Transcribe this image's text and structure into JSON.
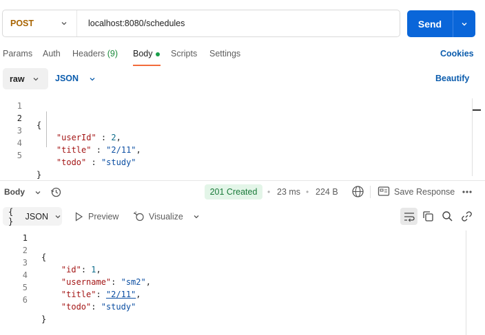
{
  "request": {
    "method": "POST",
    "url": "localhost:8080/schedules",
    "send_label": "Send"
  },
  "req_tabs": {
    "params": "Params",
    "auth": "Auth",
    "headers": "Headers",
    "headers_count": "(9)",
    "body": "Body",
    "scripts": "Scripts",
    "settings": "Settings",
    "cookies": "Cookies"
  },
  "body_mode": {
    "raw": "raw",
    "format": "JSON",
    "beautify": "Beautify"
  },
  "request_body": {
    "line_numbers": [
      "1",
      "2",
      "3",
      "4",
      "5"
    ],
    "lines": [
      {
        "segments": [
          {
            "t": "{",
            "c": "punct"
          }
        ]
      },
      {
        "segments": [
          {
            "t": "    ",
            "c": "punct"
          },
          {
            "t": "\"userId\"",
            "c": "key"
          },
          {
            "t": " : ",
            "c": "punct"
          },
          {
            "t": "2",
            "c": "num"
          },
          {
            "t": ",",
            "c": "punct"
          }
        ]
      },
      {
        "segments": [
          {
            "t": "    ",
            "c": "punct"
          },
          {
            "t": "\"title\"",
            "c": "key"
          },
          {
            "t": " : ",
            "c": "punct"
          },
          {
            "t": "\"2/11\"",
            "c": "str"
          },
          {
            "t": ",",
            "c": "punct"
          }
        ]
      },
      {
        "segments": [
          {
            "t": "    ",
            "c": "punct"
          },
          {
            "t": "\"todo\"",
            "c": "key"
          },
          {
            "t": " : ",
            "c": "punct"
          },
          {
            "t": "\"study\"",
            "c": "str"
          }
        ]
      },
      {
        "segments": [
          {
            "t": "}",
            "c": "punct"
          }
        ]
      }
    ]
  },
  "response": {
    "body_label": "Body",
    "status": "201 Created",
    "time": "23 ms",
    "size": "224 B",
    "save_label": "Save Response",
    "view_format": "JSON",
    "view_icon_text": "{ }",
    "preview": "Preview",
    "visualize": "Visualize",
    "status_color": "#1a7a3a"
  },
  "response_body": {
    "line_numbers": [
      "1",
      "2",
      "3",
      "4",
      "5",
      "6"
    ],
    "lines": [
      {
        "segments": [
          {
            "t": "{",
            "c": "punct"
          }
        ]
      },
      {
        "segments": [
          {
            "t": "    ",
            "c": "punct"
          },
          {
            "t": "\"id\"",
            "c": "key"
          },
          {
            "t": ": ",
            "c": "punct"
          },
          {
            "t": "1",
            "c": "num"
          },
          {
            "t": ",",
            "c": "punct"
          }
        ]
      },
      {
        "segments": [
          {
            "t": "    ",
            "c": "punct"
          },
          {
            "t": "\"username\"",
            "c": "key"
          },
          {
            "t": ": ",
            "c": "punct"
          },
          {
            "t": "\"sm2\"",
            "c": "str"
          },
          {
            "t": ",",
            "c": "punct"
          }
        ]
      },
      {
        "segments": [
          {
            "t": "    ",
            "c": "punct"
          },
          {
            "t": "\"title\"",
            "c": "key"
          },
          {
            "t": ": ",
            "c": "punct"
          },
          {
            "t": "\"2/11\"",
            "c": "str"
          },
          {
            "t": ",",
            "c": "punct"
          }
        ]
      },
      {
        "segments": [
          {
            "t": "    ",
            "c": "punct"
          },
          {
            "t": "\"todo\"",
            "c": "key"
          },
          {
            "t": ": ",
            "c": "punct"
          },
          {
            "t": "\"study\"",
            "c": "str"
          }
        ]
      },
      {
        "segments": [
          {
            "t": "}",
            "c": "punct"
          }
        ]
      }
    ]
  },
  "icons": {
    "method_dropdown": "chevron-down-icon",
    "send_dropdown": "chevron-down-icon",
    "history": "history-icon",
    "globe": "globe-icon",
    "save": "save-icon",
    "more": "more-icon",
    "play": "play-icon",
    "visualize": "visualize-icon",
    "wrap": "wrap-lines-icon",
    "copy": "copy-icon",
    "search": "search-icon",
    "link": "link-icon"
  },
  "colors": {
    "accent": "#0a66d9",
    "method": "#a86400",
    "active_tab_underline": "#f26b3a",
    "success_dot": "#1a9e4a"
  }
}
